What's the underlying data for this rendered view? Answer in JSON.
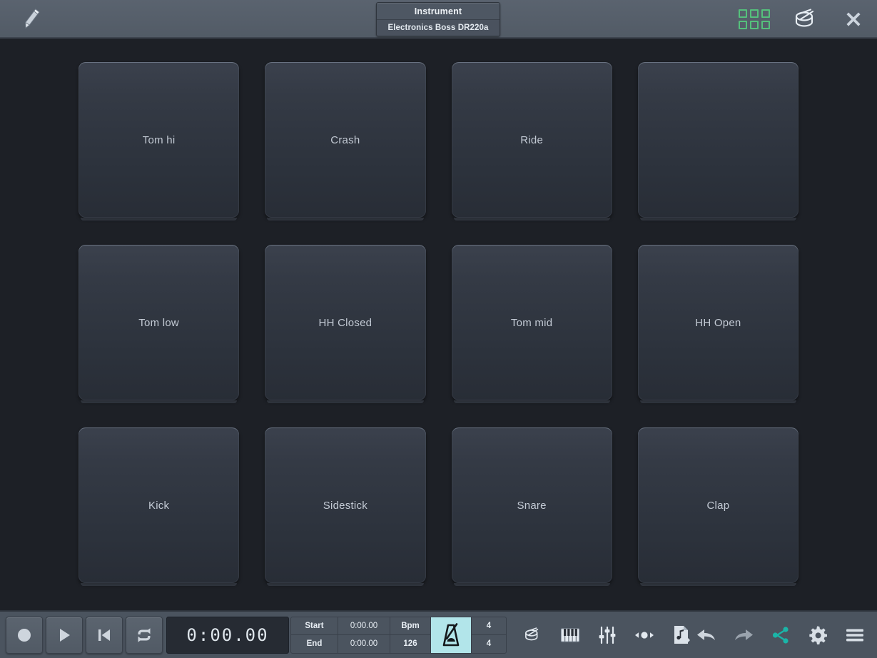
{
  "header": {
    "edit_icon": "pencil-icon",
    "instrument": {
      "title": "Instrument",
      "value": "Electronics Boss DR220a"
    },
    "grid_view_icon": "grid-icon",
    "drum_kit_icon": "drum-icon",
    "close_icon": "close-icon",
    "accent_green": "#55c07c"
  },
  "pads": [
    {
      "label": "Tom hi"
    },
    {
      "label": "Crash"
    },
    {
      "label": "Ride"
    },
    {
      "label": ""
    },
    {
      "label": "Tom low"
    },
    {
      "label": "HH Closed"
    },
    {
      "label": "Tom mid"
    },
    {
      "label": "HH Open"
    },
    {
      "label": "Kick"
    },
    {
      "label": "Sidestick"
    },
    {
      "label": "Snare"
    },
    {
      "label": "Clap"
    }
  ],
  "transport": {
    "record_icon": "record-icon",
    "play_icon": "play-icon",
    "rewind_icon": "skip-to-start-icon",
    "loop_icon": "loop-icon",
    "time": "0:00.00",
    "markers": {
      "start_label": "Start",
      "start_value": "0:00.00",
      "end_label": "End",
      "end_value": "0:00.00",
      "bpm_label": "Bpm",
      "bpm_value": "126",
      "metronome_icon": "metronome-icon",
      "metronome_active_color": "#b2e5ea",
      "time_sig_numerator": "4",
      "time_sig_denominator": "4"
    }
  },
  "toolbar": {
    "left_tools": [
      {
        "icon": "drum-icon"
      },
      {
        "icon": "piano-keyboard-icon"
      },
      {
        "icon": "mixer-sliders-icon"
      },
      {
        "icon": "midi-notes-icon"
      },
      {
        "icon": "score-file-icon"
      }
    ],
    "right_tools": [
      {
        "icon": "undo-icon"
      },
      {
        "icon": "redo-icon"
      },
      {
        "icon": "share-icon"
      },
      {
        "icon": "settings-gear-icon"
      },
      {
        "icon": "hamburger-menu-icon"
      }
    ],
    "share_color": "#1ab5a8"
  }
}
